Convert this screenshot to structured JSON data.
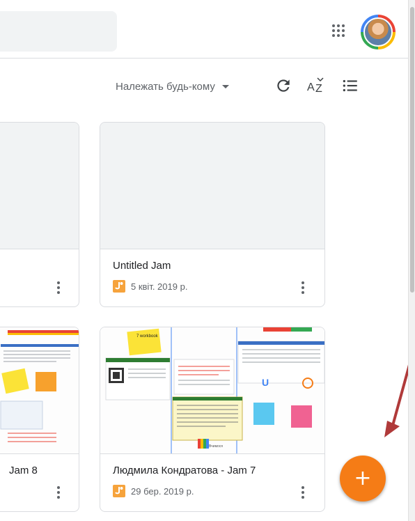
{
  "toolbar": {
    "owner_filter": "Належать будь-кому"
  },
  "icons": {
    "apps": "apps-grid-icon",
    "refresh": "refresh-icon",
    "sort": "sort-az-icon",
    "list_view": "list-view-icon",
    "jam": "jamboard-icon",
    "more": "more-vert-icon",
    "add": "add-icon"
  },
  "colors": {
    "accent": "#f57c16",
    "jam_icon": "#f6a33c"
  },
  "cards": [
    {
      "title": "",
      "date": ""
    },
    {
      "title": "Untitled Jam",
      "date": "5 квіт. 2019 р."
    },
    {
      "title": "Jam 8",
      "date": ""
    },
    {
      "title": "Людмила Кондратова - Jam 7",
      "date": "29 бер. 2019 р."
    }
  ],
  "thumbnail_text": {
    "sticky_workbook": "7 workbook",
    "sticky_1": "Створюй по вимогам",
    "sticky_2": "спільно над ресурсом",
    "ua_logo": "U",
    "handwriting": "Поділись своїм",
    "caption": "Вчимося"
  },
  "fab": {
    "label": "+"
  }
}
